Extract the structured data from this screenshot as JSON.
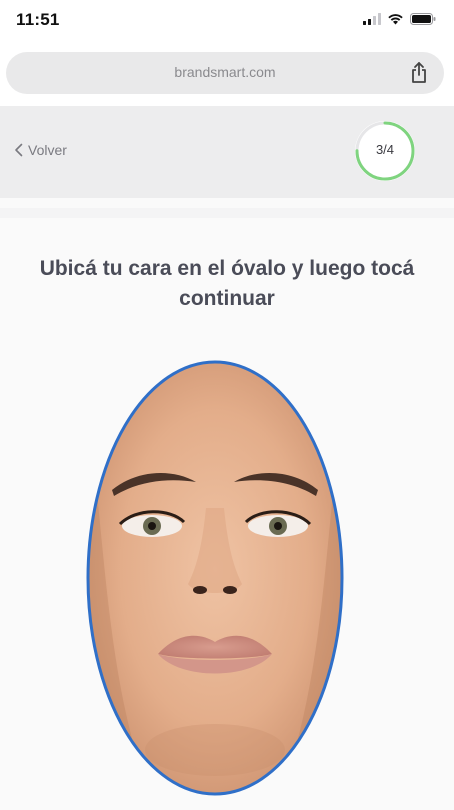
{
  "status_bar": {
    "time": "11:51",
    "icons": [
      "signal-icon",
      "wifi-icon",
      "battery-icon"
    ]
  },
  "browser": {
    "url": "brandsmart.com",
    "share_icon": "share-icon"
  },
  "header": {
    "back_label": "Volver",
    "back_icon": "chevron-left-icon",
    "progress_label": "3/4",
    "progress_value": 0.75,
    "progress_color": "#7fd47f"
  },
  "main": {
    "instruction": "Ubicá tu cara en el óvalo y luego tocá continuar",
    "oval_stroke_color": "#2f6fc8"
  }
}
